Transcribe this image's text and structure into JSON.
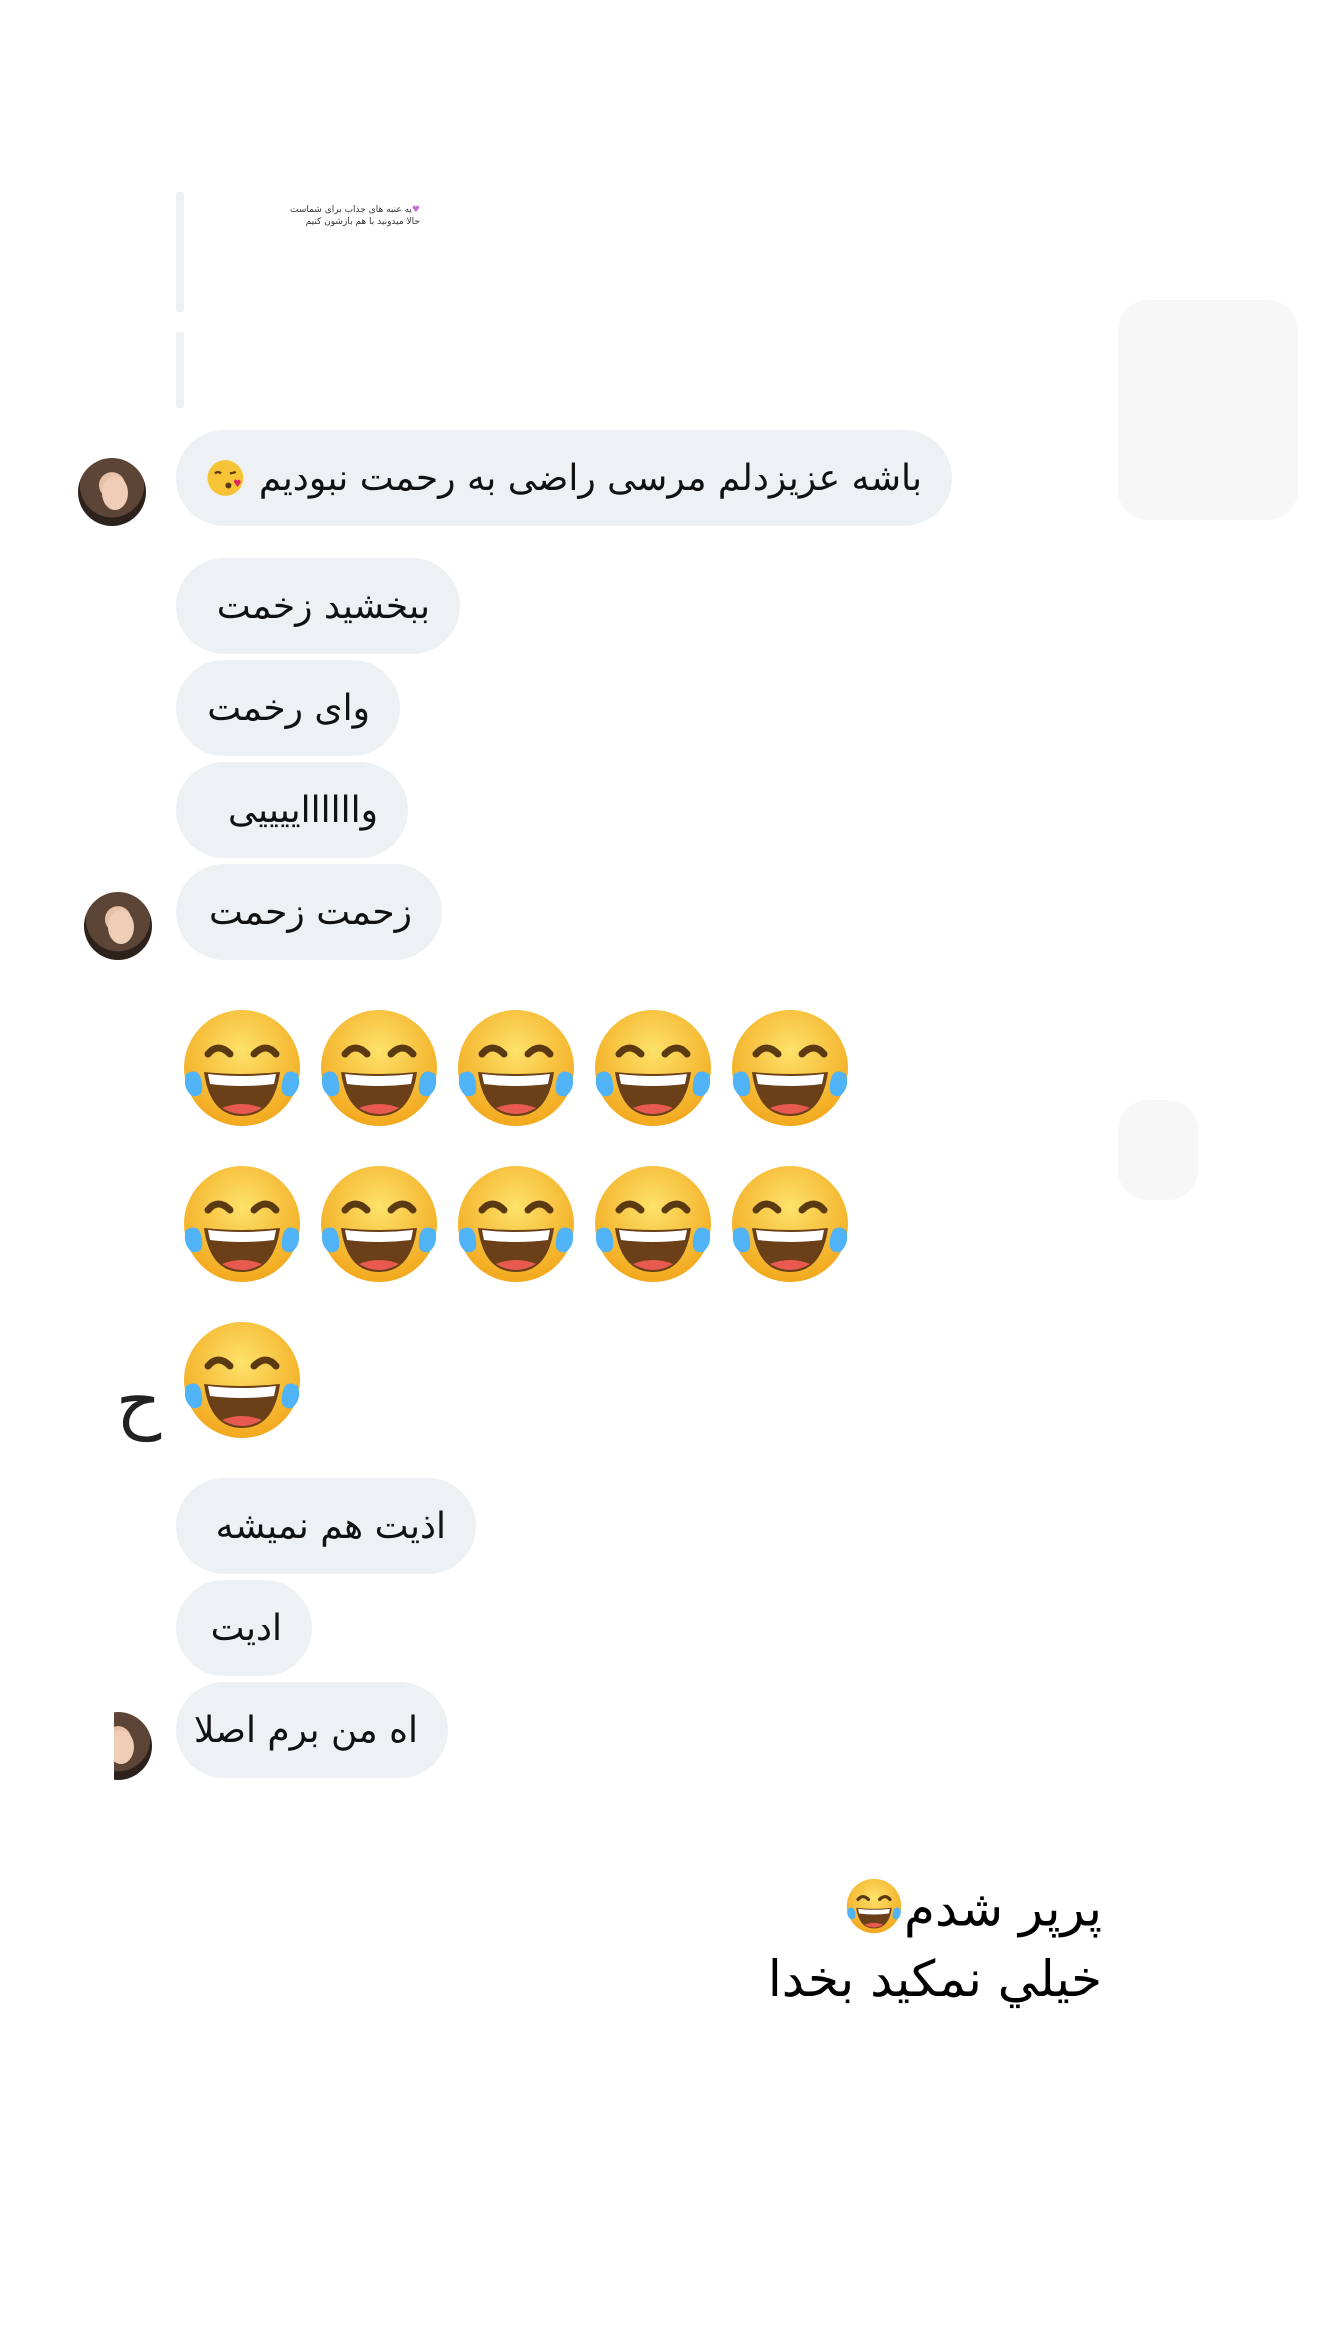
{
  "quoted_message": {
    "line1": "یه عنبه های جذاب برای شماست",
    "line2": "حالا میدونید با هم بازشون کنیم"
  },
  "messages": [
    {
      "text": "باشه عزیزدلم مرسی راضی به رحمت نبودیم",
      "emoji": "kissing-emoji"
    },
    {
      "text": "ببخشید زخمت"
    },
    {
      "text": "وای رخمت"
    },
    {
      "text": "وااااااییییی"
    },
    {
      "text": "زحمت زحمت"
    },
    {
      "text": "اذیت هم نمیشه"
    },
    {
      "text": "ادیت"
    },
    {
      "text": "اه من برم اصلا"
    }
  ],
  "emoji_message": {
    "icon": "face-with-tears-of-joy-emoji",
    "count": 11
  },
  "caption": {
    "line1": "پرپر شدم",
    "line2": "خيلي نمكيد بخدا"
  },
  "colors": {
    "bubble": "#eef1f4",
    "text": "#111111",
    "background": "#ffffff"
  }
}
